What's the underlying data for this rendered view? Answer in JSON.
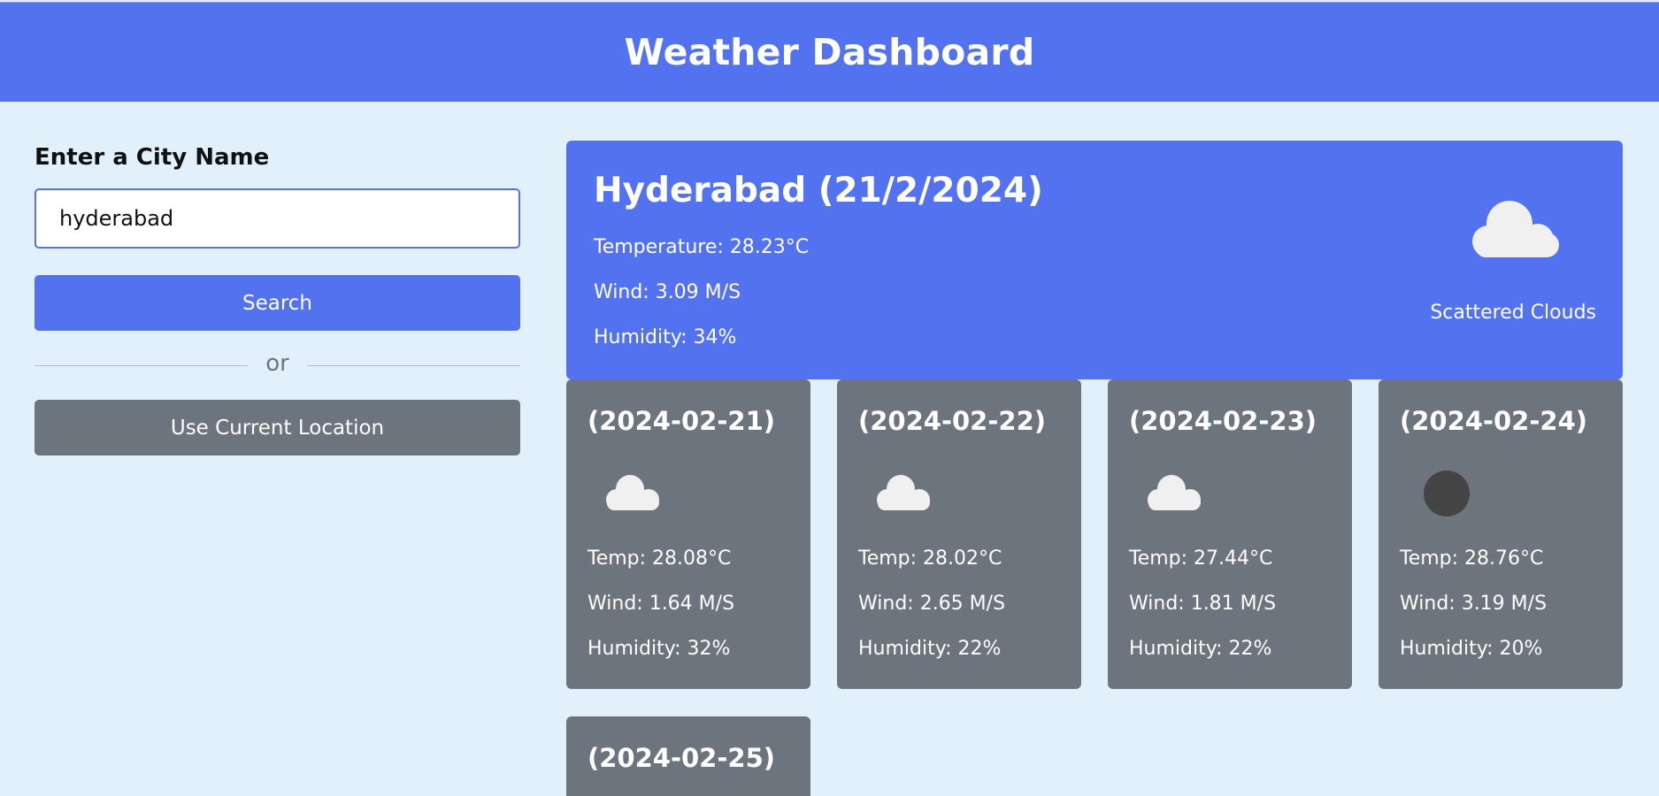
{
  "header": {
    "title": "Weather Dashboard"
  },
  "search": {
    "label": "Enter a City Name",
    "input_value": "hyderabad",
    "search_button": "Search",
    "divider_text": "or",
    "location_button": "Use Current Location"
  },
  "current": {
    "title": "Hyderabad (21/2/2024)",
    "temperature": "Temperature: 28.23°C",
    "wind": "Wind: 3.09 M/S",
    "humidity": "Humidity: 34%",
    "description": "Scattered Clouds",
    "icon": "cloud-icon"
  },
  "forecast": [
    {
      "date": "(2024-02-21)",
      "temp": "Temp: 28.08°C",
      "wind": "Wind: 1.64 M/S",
      "humidity": "Humidity: 32%",
      "icon": "cloud-icon"
    },
    {
      "date": "(2024-02-22)",
      "temp": "Temp: 28.02°C",
      "wind": "Wind: 2.65 M/S",
      "humidity": "Humidity: 22%",
      "icon": "cloud-icon"
    },
    {
      "date": "(2024-02-23)",
      "temp": "Temp: 27.44°C",
      "wind": "Wind: 1.81 M/S",
      "humidity": "Humidity: 22%",
      "icon": "cloud-icon"
    },
    {
      "date": "(2024-02-24)",
      "temp": "Temp: 28.76°C",
      "wind": "Wind: 3.19 M/S",
      "humidity": "Humidity: 20%",
      "icon": "moon-icon"
    },
    {
      "date": "(2024-02-25)"
    }
  ],
  "colors": {
    "primary": "#5372f0",
    "secondary": "#6c757d",
    "background": "#e2f0fc"
  }
}
